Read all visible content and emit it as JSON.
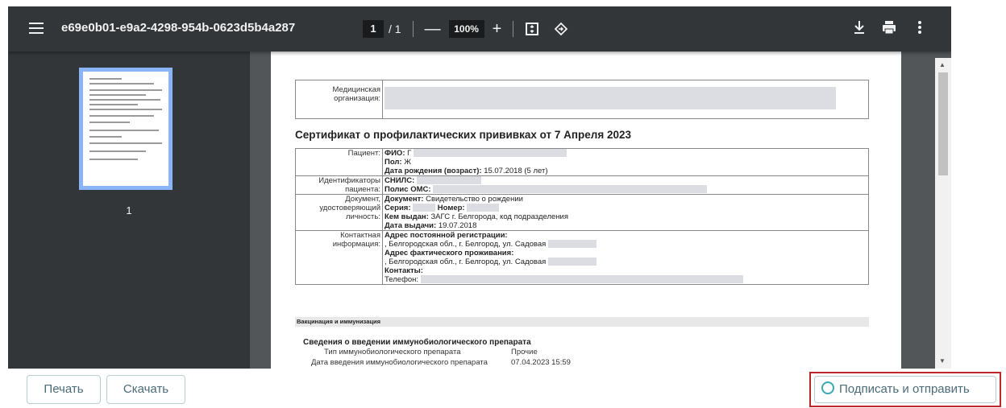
{
  "viewer": {
    "title": "e69e0b01-e9a2-4298-954b-0623d5b4a287",
    "page_current": "1",
    "page_sep": "/",
    "page_total": "1",
    "zoom": "100%",
    "zoom_out": "—",
    "zoom_in": "+",
    "thumb_label": "1"
  },
  "doc": {
    "org_label": "Медицинская организация:",
    "cert_title": "Сертификат о профилактических прививках от 7 Апреля 2023",
    "patient_label": "Пациент:",
    "fio_label": "ФИО:",
    "fio_value": "Г",
    "sex_label": "Пол:",
    "sex_value": "Ж",
    "dob_label": "Дата рождения (возраст):",
    "dob_value": "15.07.2018 (5 лет)",
    "ident_label": "Идентификаторы пациента:",
    "snils_label": "СНИЛС:",
    "oms_label": "Полис ОМС:",
    "idoc_label": "Документ, удостоверяющий личность:",
    "doc_label": "Документ:",
    "doc_value": "Свидетельство о рождении",
    "series_label": "Серия:",
    "number_label": "Номер:",
    "issued_label": "Кем выдан:",
    "issued_value": "ЗАГС г. Белгорода, код подразделения",
    "issue_date_label": "Дата выдачи:",
    "issue_date_value": "19.07.2018",
    "contact_label": "Контактная информация:",
    "reg_addr_label": "Адрес постоянной регистрации:",
    "reg_addr_value": ", Белгородская обл., г. Белгород, ул. Садовая",
    "fact_addr_label": "Адрес фактического проживания:",
    "fact_addr_value": ", Белгородская обл., г. Белгород, ул. Садовая",
    "contacts_label": "Контакты:",
    "phone_label": "Телефон:",
    "vac_section": "Вакцинация и иммунизация",
    "vac_heading": "Сведения о введении иммунобиологического препарата",
    "type_label": "Тип иммунобиологического препарата",
    "type_value": "Прочие",
    "date_label": "Дата введения иммунобиологического препарата",
    "date_value": "07.04.2023 15:59"
  },
  "actions": {
    "print": "Печать",
    "download": "Скачать",
    "sign": "Подписать и отправить"
  },
  "colors": {
    "toolbar": "#323639",
    "accent_border": "#c0272d",
    "button_text": "#4b6b78",
    "sign_icon": "#38a9b4"
  }
}
